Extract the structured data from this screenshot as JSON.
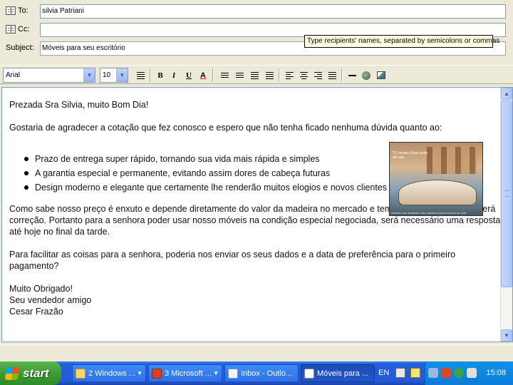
{
  "header": {
    "to_label": "To:",
    "to_value": "silvia Patriani",
    "cc_label": "Cc:",
    "cc_value": "",
    "subject_label": "Subject:",
    "subject_value": "Móveis para seu escritório",
    "tooltip": "Type recipients' names, separated by semicolons or commas"
  },
  "toolbar": {
    "font": "Arial",
    "size": "10",
    "bold": "B",
    "italic": "I",
    "underline": "U",
    "font_color": "A"
  },
  "body": {
    "greeting": "Prezada Sra Silvia, muito Bom Dia!",
    "intro": "Gostaria de agradecer a cotação que fez conosco e espero que não tenha ficado nenhuma dúvida quanto ao:",
    "bullets": [
      "Prazo de entrega super rápido, tornando sua vida mais rápida e simples",
      "A garantia especial e permanente, evitando assim dores de cabeça futuras",
      "Design moderno e elegante que certamente lhe renderão muitos elogios e novos clientes"
    ],
    "paragraph2": "Como sabe nosso preço é enxuto e depende diretamente do valor da madeira no mercado e temos informação que sofrerá correção.  Portanto para a senhora poder usar nosso móveis na condição especial negociada, será necessário uma resposta até hoje no final da tarde.",
    "paragraph3": "Para facilitar as coisas para a senhora,  poderia nos enviar os seus dados e a data de preferência para o primeiro pagamento?",
    "closing1": "Muito Obrigado!",
    "closing2": "Seu vendedor amigo",
    "closing3": "Cesar Frazão",
    "photo_caption_top": "TC moveis\nEsse pode ser seu",
    "photo_caption_bottom": "melhore seu ambiente com móveis à prova de tudo de tudo"
  },
  "taskbar": {
    "start": "start",
    "tasks": [
      {
        "label": "2 Windows ..."
      },
      {
        "label": "3 Microsoft ..."
      },
      {
        "label": "Inbox - Outlo..."
      },
      {
        "label": "Móveis para ..."
      }
    ],
    "language": "EN",
    "clock": "15:08"
  }
}
